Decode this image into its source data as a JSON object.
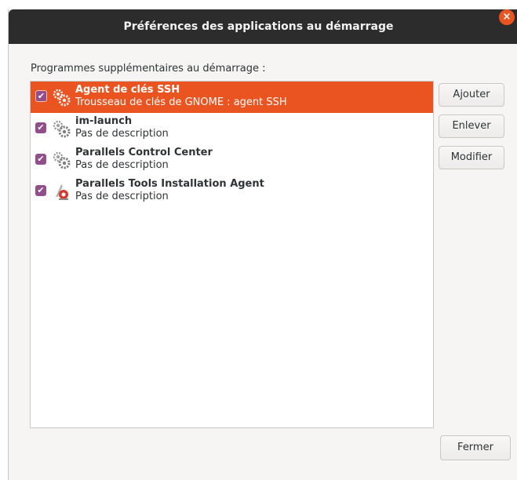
{
  "window": {
    "title": "Préférences des applications au démarrage",
    "close_icon": "close-icon"
  },
  "section": {
    "label": "Programmes supplémentaires au démarrage :"
  },
  "programs": [
    {
      "name": "Agent de clés SSH",
      "description": "Trousseau de clés de GNOME : agent SSH",
      "checked": true,
      "selected": true,
      "icon": "gears-icon"
    },
    {
      "name": "im-launch",
      "description": "Pas de description",
      "checked": true,
      "selected": false,
      "icon": "gears-icon"
    },
    {
      "name": "Parallels Control Center",
      "description": "Pas de description",
      "checked": true,
      "selected": false,
      "icon": "gears-icon"
    },
    {
      "name": "Parallels Tools Installation Agent",
      "description": "Pas de description",
      "checked": true,
      "selected": false,
      "icon": "parallels-icon"
    }
  ],
  "buttons": {
    "add": "Ajouter",
    "remove": "Enlever",
    "edit": "Modifier",
    "close": "Fermer"
  },
  "colors": {
    "accent": "#e95420",
    "checkbox": "#924d8b",
    "titlebar": "#2c2c2c"
  }
}
